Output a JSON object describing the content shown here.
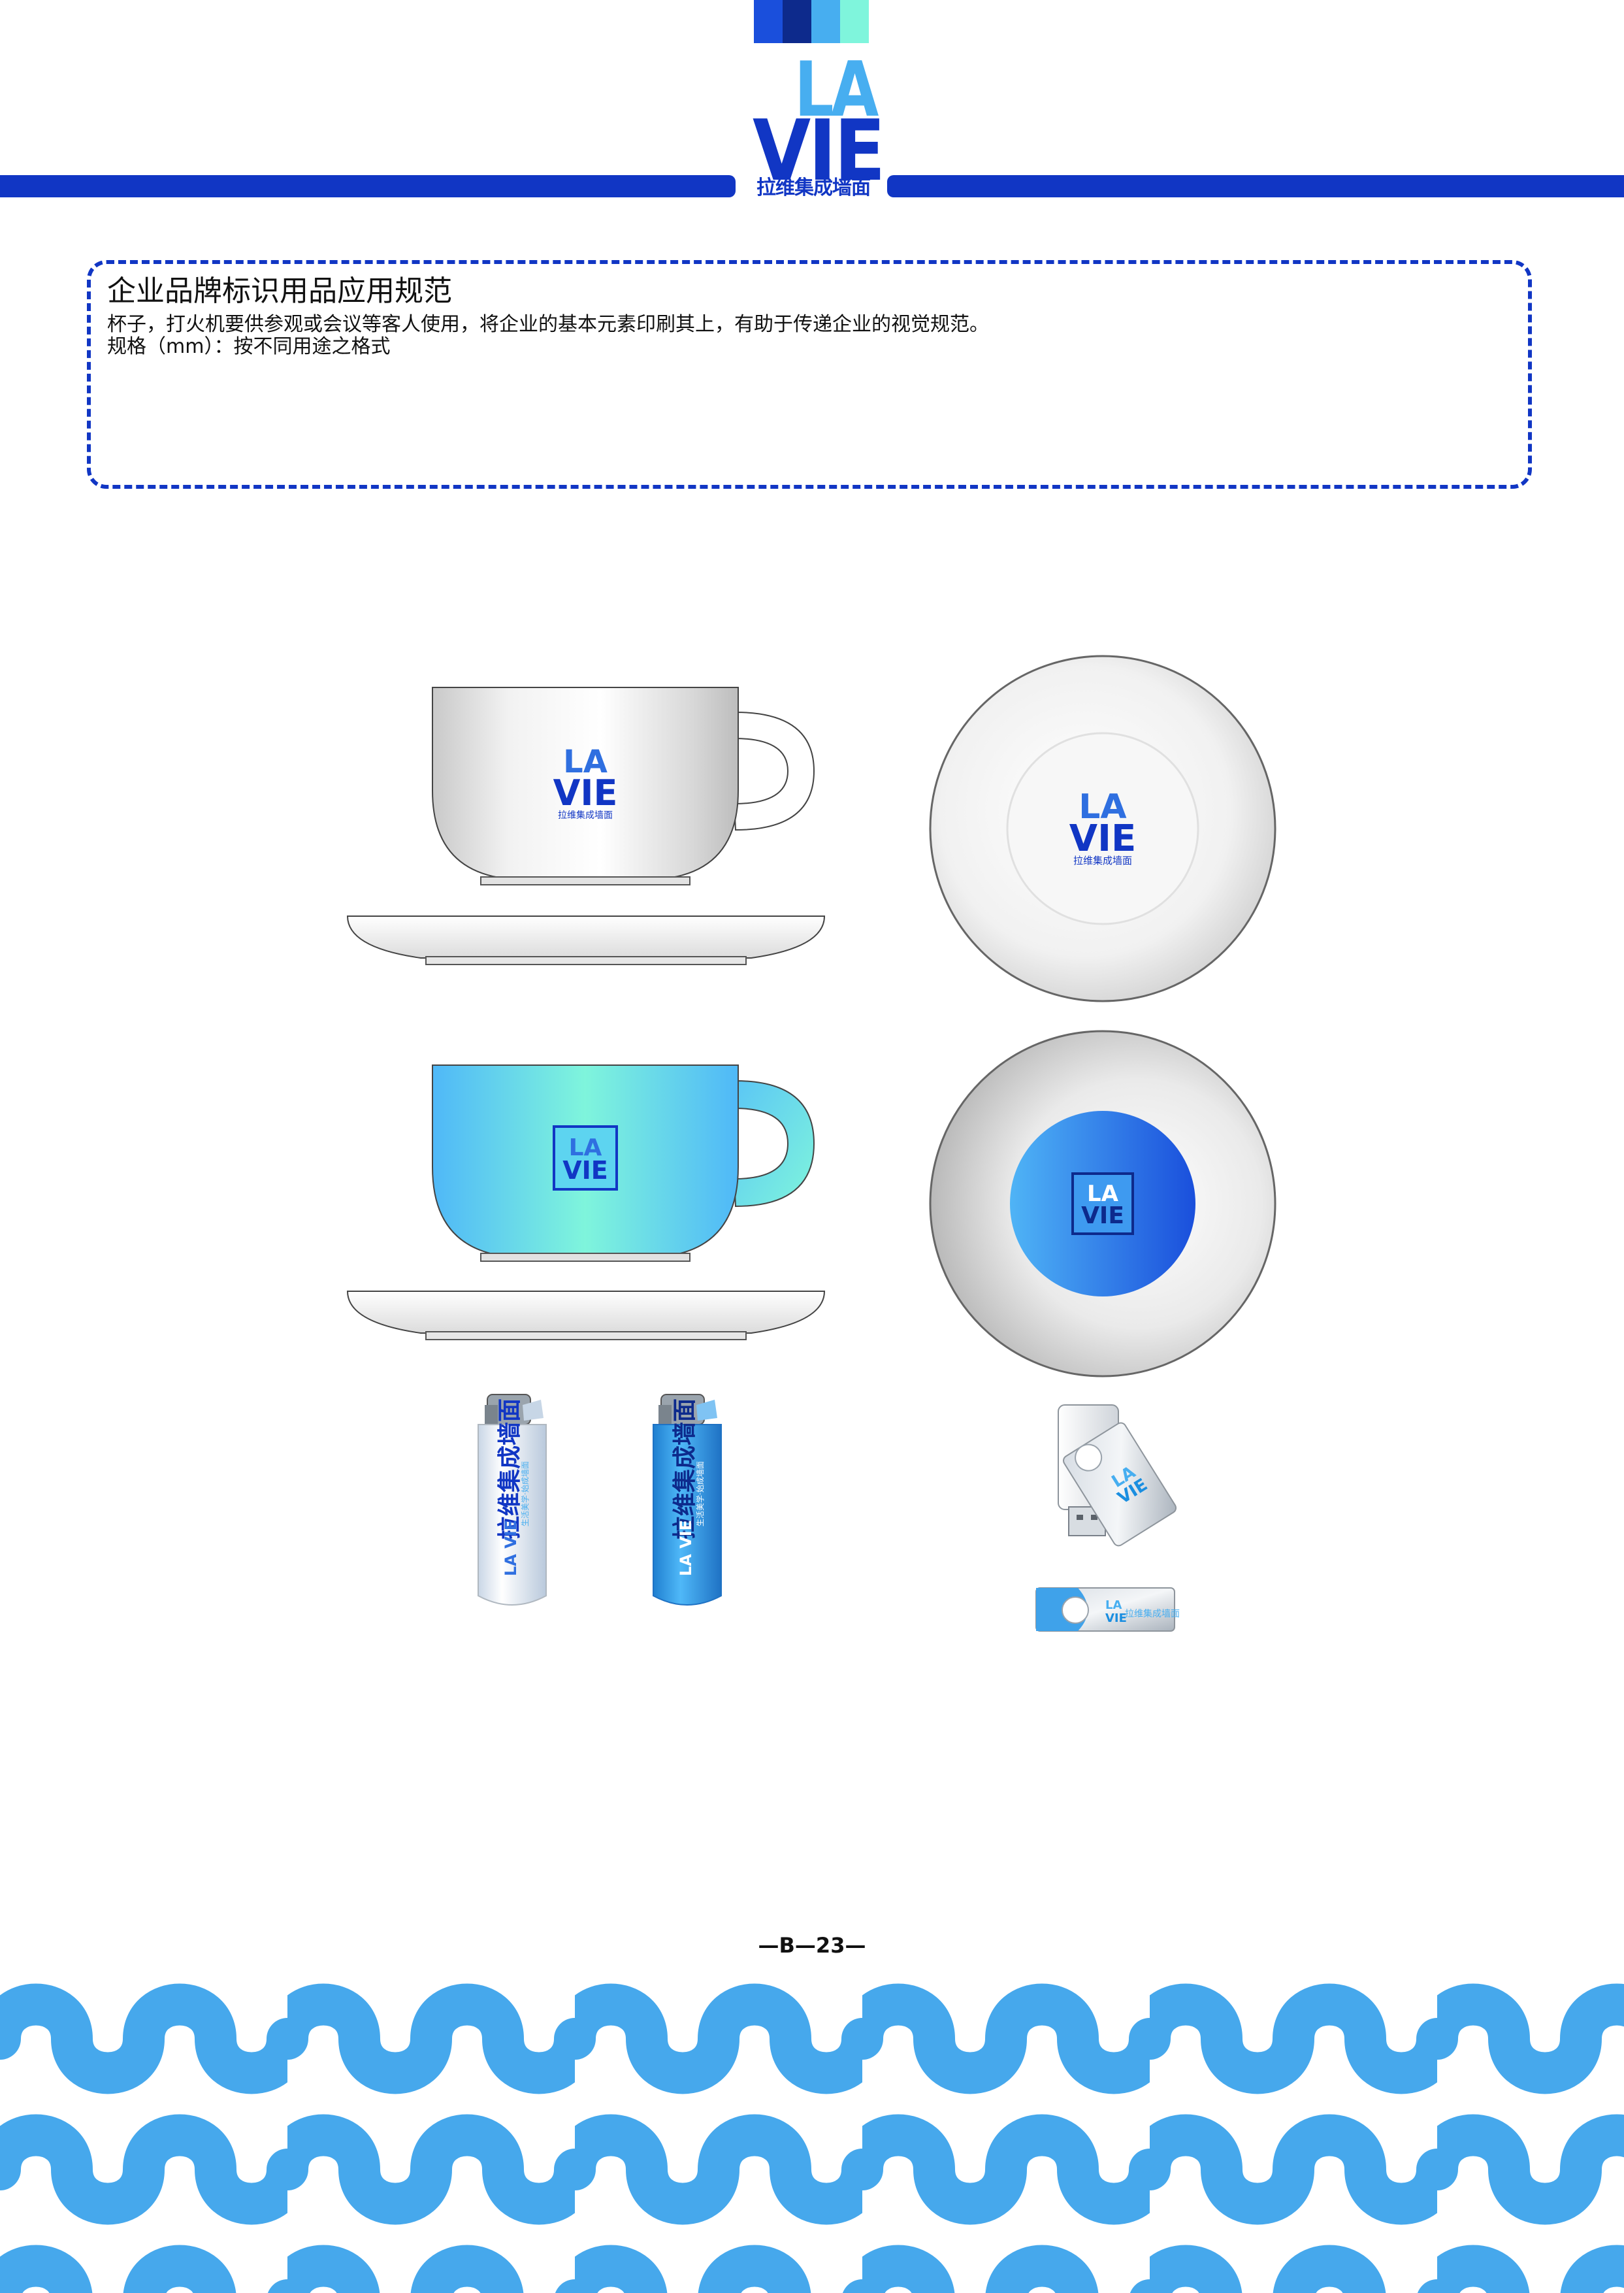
{
  "brand": {
    "logo_top": "LA",
    "logo_bottom": "VIE",
    "logo_subtitle": "拉维集成墙面",
    "color_primary": "#1136c4",
    "color_secondary": "#47aef0",
    "color_accent": "#7ff5dc",
    "color_blocks": [
      "#1a4fdc",
      "#0d2a8c",
      "#47aef0",
      "#7ff5dc"
    ]
  },
  "spec": {
    "title": "企业品牌标识用品应用规范",
    "line1": "杯子，打火机要供参观或会议等客人使用，将企业的基本元素印刷其上，有助于传递企业的视觉规范。",
    "line2": "规格（mm）：按不同用途之格式"
  },
  "items": {
    "lighter_text": "拉维集成墙面",
    "lighter_tagline": "生活美学·始成墙面"
  },
  "footer": {
    "page_number": "—B—23—"
  }
}
